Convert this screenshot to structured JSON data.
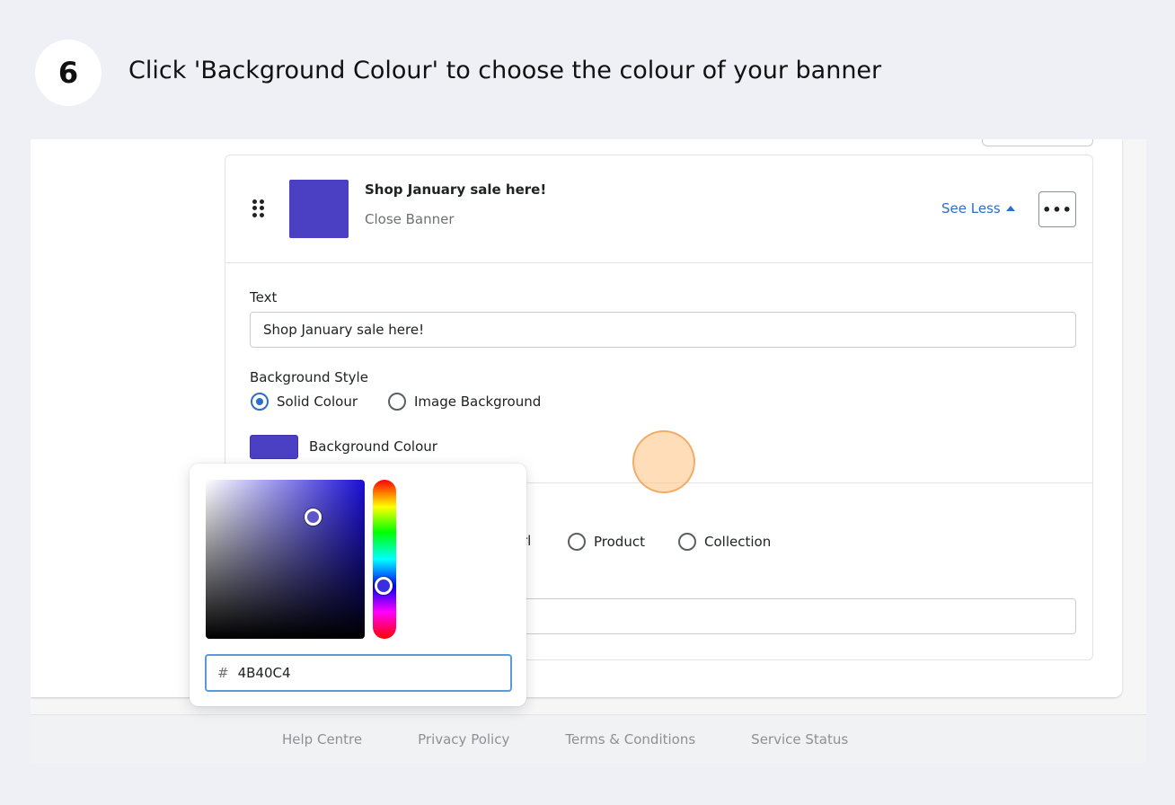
{
  "step": {
    "number": "6",
    "instruction": "Click 'Background Colour' to choose the colour of your banner"
  },
  "banner": {
    "title": "Shop January sale here!",
    "subtitle": "Close Banner",
    "toggle_label": "See Less",
    "more_label": "•••",
    "thumbnail_color": "#4B40C4"
  },
  "form": {
    "text_label": "Text",
    "text_value": "Shop January sale here!",
    "background_style_label": "Background Style",
    "style_options": [
      {
        "label": "Solid Colour",
        "selected": true
      },
      {
        "label": "Image Background",
        "selected": false
      }
    ],
    "background_colour_label": "Background Colour",
    "link_options_partial": "rl",
    "link_options": [
      {
        "label": "Product",
        "selected": false
      },
      {
        "label": "Collection",
        "selected": false
      }
    ]
  },
  "color_picker": {
    "hash": "#",
    "hex_value": "4B40C4"
  },
  "footer": {
    "links": [
      "Help Centre",
      "Privacy Policy",
      "Terms & Conditions",
      "Service Status"
    ]
  },
  "colors": {
    "accent": "#2c6ecb",
    "selected_colour": "#4B40C4",
    "click_highlight": "#fdc88c"
  }
}
